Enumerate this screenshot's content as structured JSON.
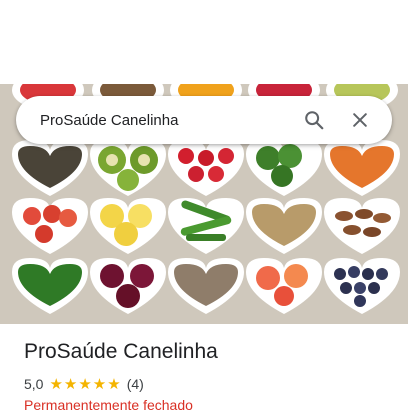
{
  "search": {
    "query": "ProSaúde Canelinha",
    "search_icon": "search-icon",
    "close_icon": "close-icon"
  },
  "place": {
    "name": "ProSaúde Canelinha",
    "rating": "5,0",
    "stars": "★★★★★",
    "reviews": "(4)",
    "status": "Permanentemente fechado"
  },
  "colors": {
    "star": "#f4b400",
    "status": "#d93025",
    "text": "#202124"
  }
}
